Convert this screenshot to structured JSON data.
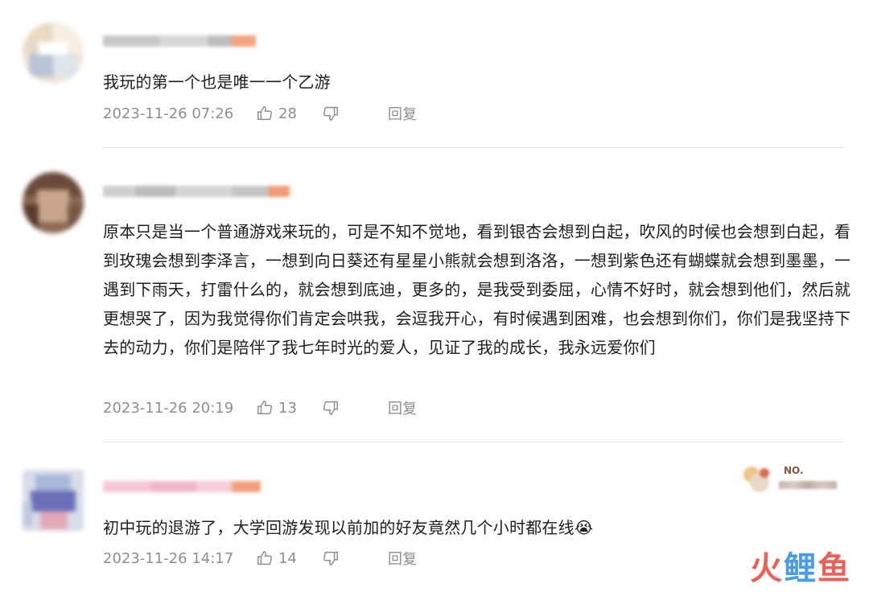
{
  "comments": [
    {
      "content": "我玩的第一个也是唯一一个乙游",
      "time": "2023-11-26 07:26",
      "likes": "28",
      "reply_label": "回复"
    },
    {
      "content": "原本只是当一个普通游戏来玩的，可是不知不觉地，看到银杏会想到白起，吹风的时候也会想到白起，看到玫瑰会想到李泽言，一想到向日葵还有星星小熊就会想到洛洛，一想到紫色还有蝴蝶就会想到墨墨，一遇到下雨天，打雷什么的，就会想到底迪，更多的，是我受到委屈，心情不好时，就会想到他们，然后就更想哭了，因为我觉得你们肯定会哄我，会逗我开心，有时候遇到困难，也会想到你们，你们是我坚持下去的动力，你们是陪伴了我七年时光的爱人，见证了我的成长，我永远爱你们",
      "time": "2023-11-26 20:19",
      "likes": "13",
      "reply_label": "回复"
    },
    {
      "content": "初中玩的退游了，大学回游发现以前加的好友竟然几个小时都在线",
      "emoji": "😭",
      "time": "2023-11-26 14:17",
      "likes": "14",
      "reply_label": "回复",
      "badge": {
        "label": "NO."
      }
    }
  ],
  "watermark": {
    "part1": "火",
    "part2": "鲤",
    "part3": "鱼"
  },
  "colors": {
    "meta_text": "#8e8e8e",
    "content_text": "#1e1e1e",
    "divider": "#e6e6e6",
    "username_accent": "#f28b62"
  }
}
